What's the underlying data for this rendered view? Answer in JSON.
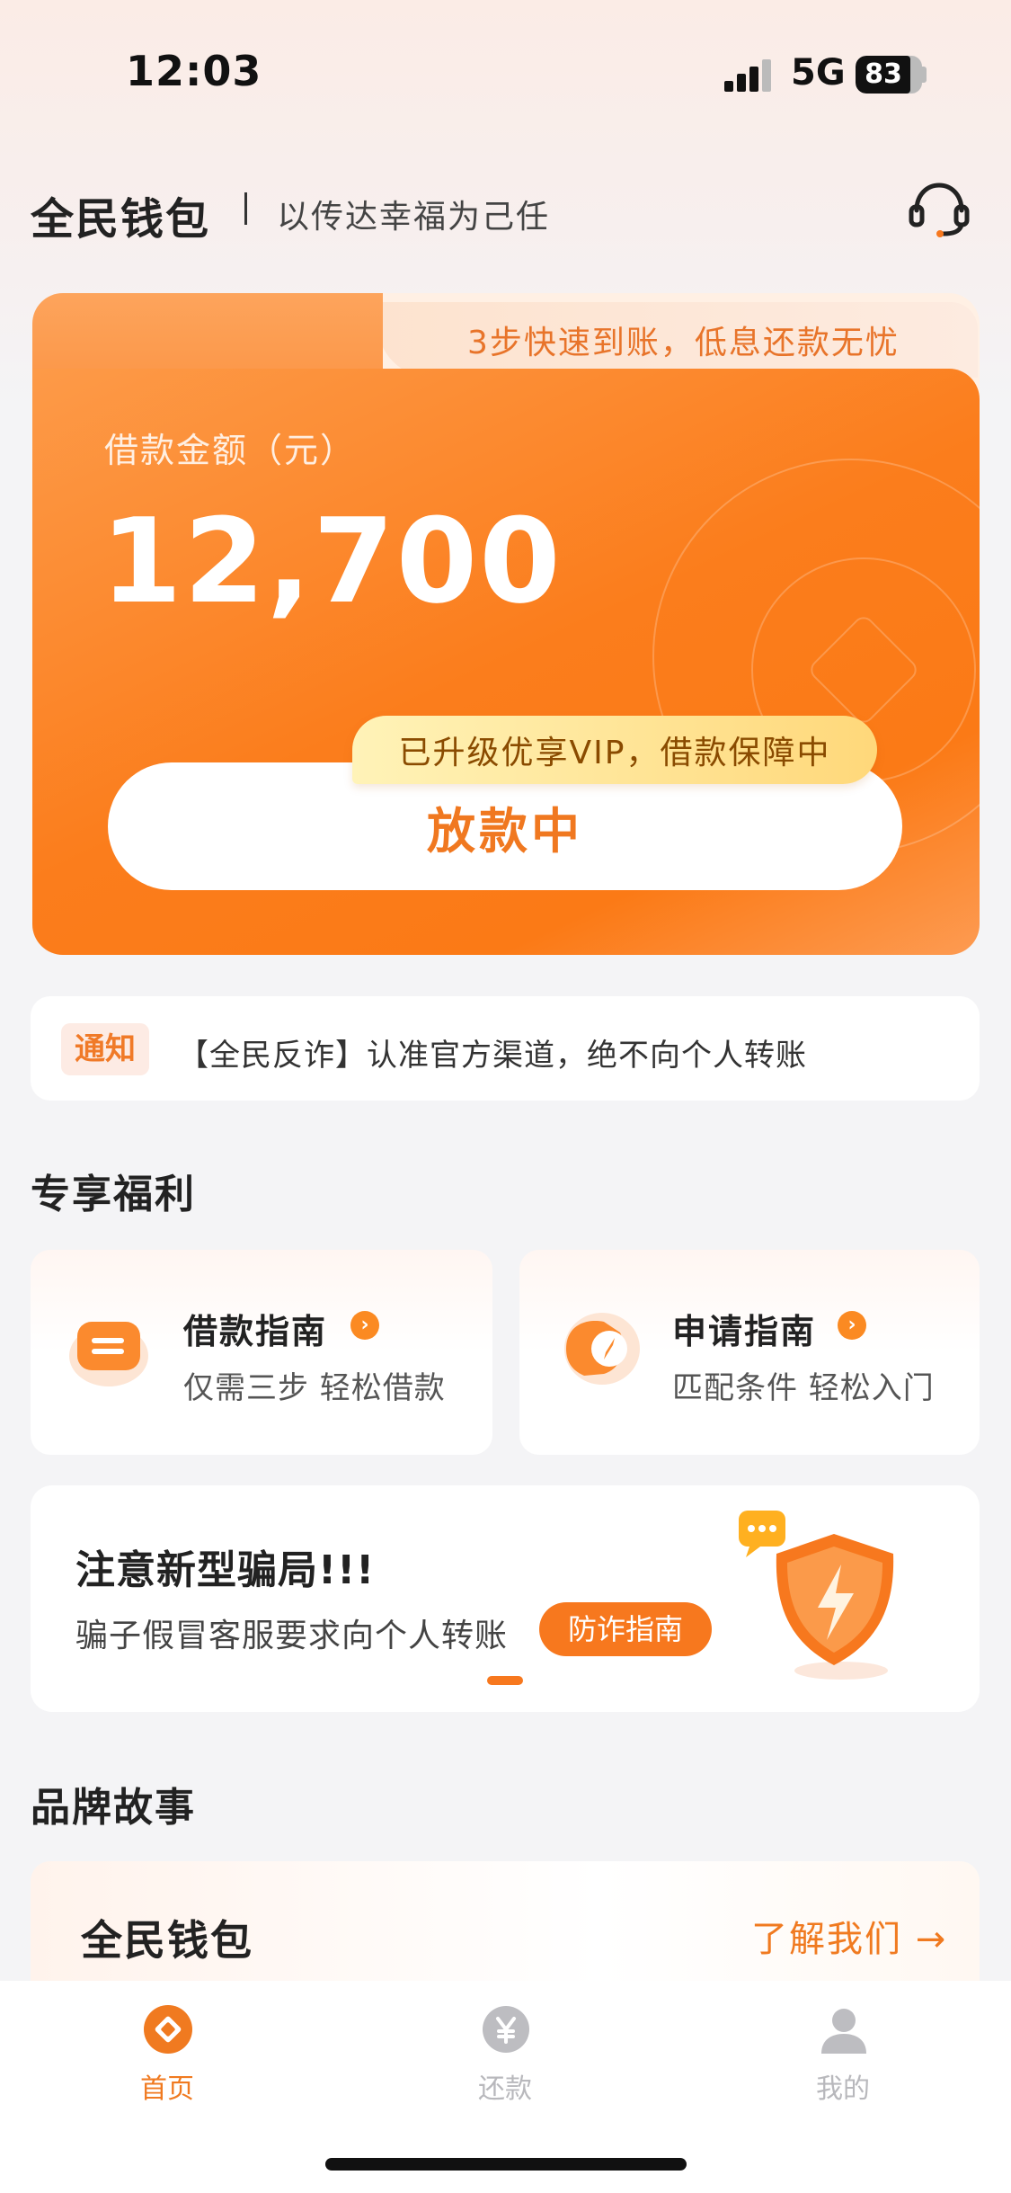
{
  "status_bar": {
    "time": "12:03",
    "network": "5G",
    "battery": "83"
  },
  "header": {
    "brand": "全民钱包",
    "slogan": "以传达幸福为己任",
    "service_icon": "headset-icon"
  },
  "loan_card": {
    "tab_text": "3步快速到账，低息还款无忧",
    "amount_label": "借款金额（元）",
    "amount": "12,700",
    "vip_tag": "已升级优享VIP，借款保障中",
    "button_label": "放款中"
  },
  "notice": {
    "badge": "通知",
    "text": "【全民反诈】认准官方渠道，绝不向个人转账"
  },
  "benefits": {
    "title": "专享福利",
    "items": [
      {
        "title": "借款指南",
        "subtitle": "仅需三步 轻松借款",
        "icon": "ticket-icon"
      },
      {
        "title": "申请指南",
        "subtitle": "匹配条件 轻松入门",
        "icon": "compass-icon"
      }
    ]
  },
  "fraud_banner": {
    "title": "注意新型骗局!!!",
    "subtitle": "骗子假冒客服要求向个人转账",
    "button": "防诈指南",
    "icon": "shield-lightning-icon"
  },
  "brand_story": {
    "title": "品牌故事",
    "card_title": "全民钱包",
    "link": "了解我们 →",
    "subtitle": ""
  },
  "tabbar": {
    "items": [
      {
        "label": "首页",
        "icon": "home-icon",
        "active": true
      },
      {
        "label": "还款",
        "icon": "yen-icon",
        "active": false
      },
      {
        "label": "我的",
        "icon": "user-icon",
        "active": false
      }
    ]
  },
  "colors": {
    "accent": "#f7781e",
    "active_tab": "#f07a20",
    "inactive_tab": "#b8b8bc"
  }
}
